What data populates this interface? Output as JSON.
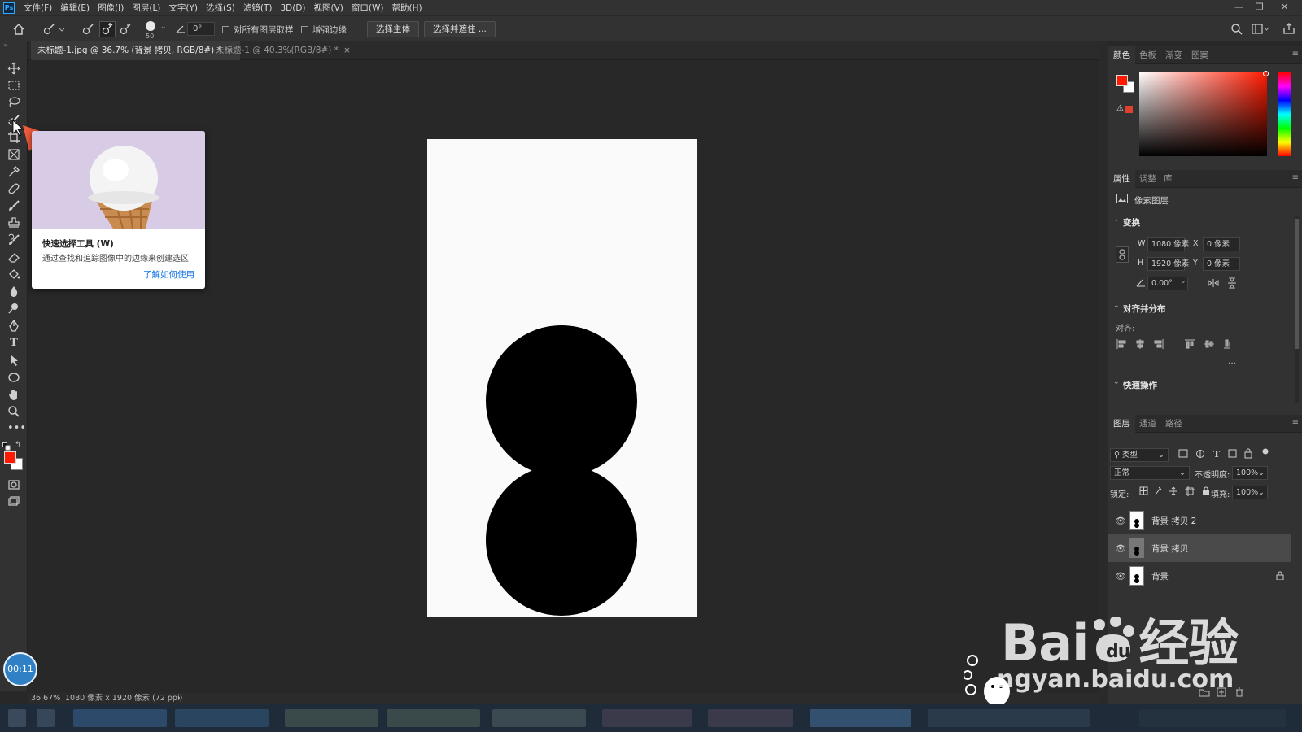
{
  "menubar": {
    "logo": "Ps",
    "items": [
      "文件(F)",
      "编辑(E)",
      "图像(I)",
      "图层(L)",
      "文字(Y)",
      "选择(S)",
      "滤镜(T)",
      "3D(D)",
      "视图(V)",
      "窗口(W)",
      "帮助(H)"
    ]
  },
  "options": {
    "brush_size": "50",
    "angle": "0°",
    "sample_all_layers": "对所有图层取样",
    "enhance_edge": "增强边缘",
    "select_subject": "选择主体",
    "select_and_mask": "选择并遮住 ..."
  },
  "tabs": [
    {
      "label": "未标题-1.jpg @ 36.7% (背景 拷贝, RGB/8#) *",
      "close": "×"
    },
    {
      "label": "未标题-1 @ 40.3%(RGB/8#) *",
      "close": "×"
    }
  ],
  "tooltip": {
    "title": "快速选择工具 (W)",
    "description": "通过查找和追踪图像中的边缘来创建选区",
    "link": "了解如何使用"
  },
  "status": {
    "zoom": "36.67%",
    "doc_info": "1080 像素 x 1920 像素 (72 ppi)",
    "arrow": "›"
  },
  "color_panel": {
    "tabs": [
      "颜色",
      "色板",
      "渐变",
      "图案"
    ],
    "foreground": "#ff1a00",
    "background": "#ffffff"
  },
  "properties_panel": {
    "tabs": [
      "属性",
      "调整",
      "库"
    ],
    "layer_type": "像素图层",
    "transform_heading": "变换",
    "w_label": "W",
    "w_value": "1080 像素",
    "h_label": "H",
    "h_value": "1920 像素",
    "x_label": "X",
    "x_value": "0 像素",
    "y_label": "Y",
    "y_value": "0 像素",
    "angle_value": "0.00°",
    "align_heading": "对齐并分布",
    "align_label": "对齐:",
    "more": "...",
    "quick_actions_heading": "快速操作"
  },
  "layers_panel": {
    "tabs": [
      "图层",
      "通道",
      "路径"
    ],
    "filter_kind": "类型",
    "blend_mode": "正常",
    "opacity_label": "不透明度:",
    "opacity_value": "100%",
    "lock_label": "锁定:",
    "fill_label": "填充:",
    "fill_value": "100%",
    "layers": [
      {
        "name": "背景 拷贝 2",
        "selected": false,
        "locked": false
      },
      {
        "name": "背景 拷贝",
        "selected": true,
        "locked": false
      },
      {
        "name": "背景",
        "selected": false,
        "locked": true
      }
    ]
  },
  "timer": "00:11",
  "watermark": {
    "main": "Bai",
    "main2": "du",
    "suffix": "经验",
    "sub": "ngyan.baidu.com"
  },
  "colors": {
    "accent_blue": "#1473e6",
    "fg_red": "#ff1a00"
  }
}
